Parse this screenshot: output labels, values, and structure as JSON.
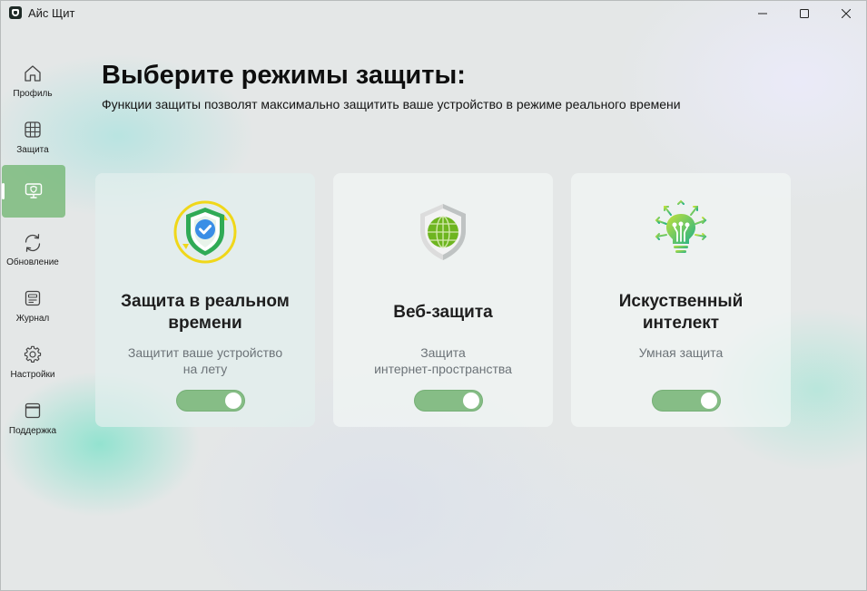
{
  "window": {
    "title": "Айс Щит",
    "controls": [
      "minimize",
      "maximize",
      "close"
    ]
  },
  "sidebar": {
    "items": [
      {
        "label": "Профиль",
        "icon": "home-icon",
        "active": false
      },
      {
        "label": "Защита",
        "icon": "grid-icon",
        "active": false
      },
      {
        "label": "",
        "icon": "monitor-shield-icon",
        "active": true
      },
      {
        "label": "Обновление",
        "icon": "refresh-icon",
        "active": false
      },
      {
        "label": "Журнал",
        "icon": "journal-icon",
        "active": false
      },
      {
        "label": "Настройки",
        "icon": "gear-icon",
        "active": false
      },
      {
        "label": "Поддержка",
        "icon": "window-icon",
        "active": false
      }
    ]
  },
  "header": {
    "title": "Выберите режимы защиты:",
    "subtitle": "Функции защиты позволят максимально защитить ваше устройство в режиме реального времени"
  },
  "cards": [
    {
      "icon": "realtime-shield-icon",
      "title_lines": [
        "Защита в реальном",
        "времени"
      ],
      "desc_lines": [
        "Защитит ваше устройство",
        "на лету"
      ],
      "enabled": true
    },
    {
      "icon": "web-shield-icon",
      "title_lines": [
        "Веб-защита"
      ],
      "desc_lines": [
        "Защита",
        "интернет-пространства"
      ],
      "enabled": true
    },
    {
      "icon": "ai-bulb-icon",
      "title_lines": [
        "Искуственный",
        "интелект"
      ],
      "desc_lines": [
        "Умная защита"
      ],
      "enabled": true
    }
  ],
  "colors": {
    "accent": "#86bd86",
    "active_nav": "#6eb46e",
    "title_text": "#0e0e0e",
    "desc_text": "#6c7378"
  }
}
